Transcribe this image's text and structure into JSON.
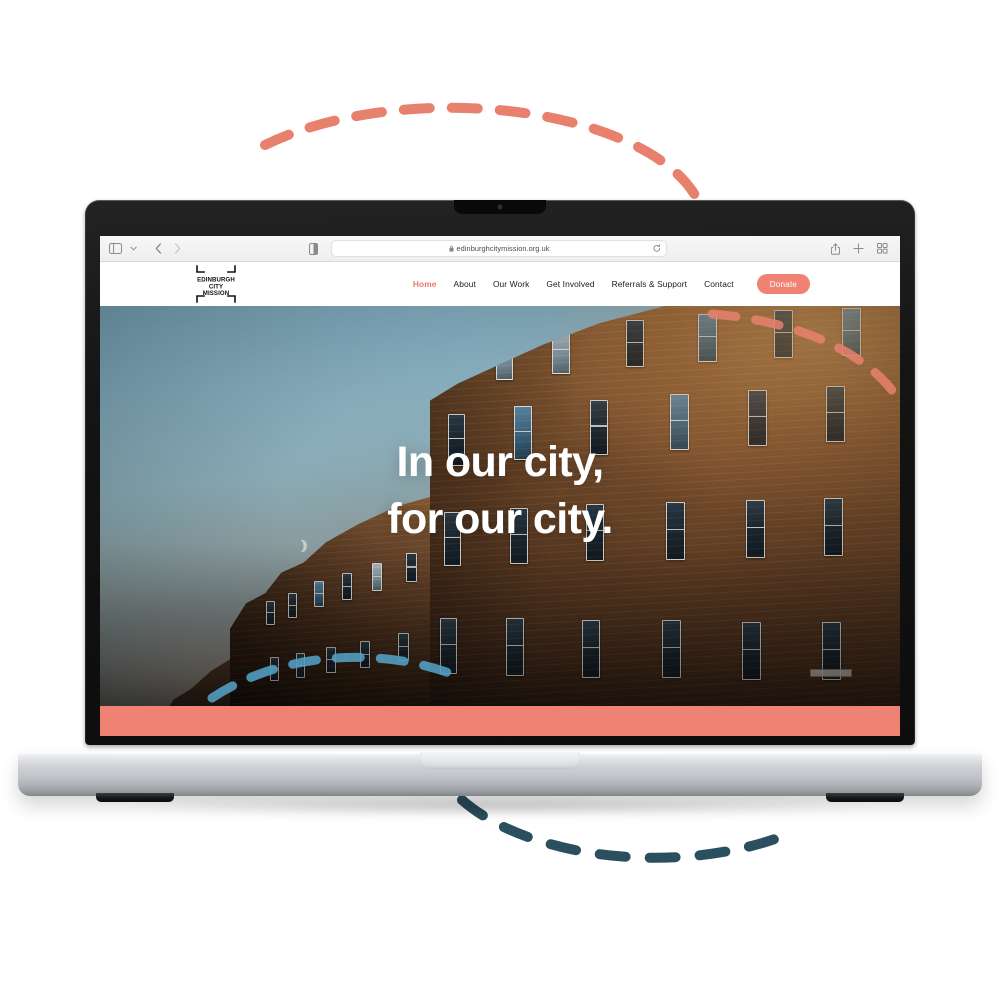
{
  "device": {
    "type": "laptop-mockup",
    "camera_label": "webcam"
  },
  "browser": {
    "app": "safari",
    "url": "edinburghcitymission.org.uk",
    "lock_icon": "lock-icon",
    "reload_icon": "reload-icon",
    "sidebar_icon": "sidebar-toggle-icon",
    "tab_group_chevron": "chevron-down-icon",
    "back_icon": "back-chevron-icon",
    "forward_icon": "forward-chevron-icon",
    "reader_icon": "reader-view-icon",
    "share_icon": "share-icon",
    "new_tab_icon": "plus-icon",
    "tab_overview_icon": "tab-overview-icon"
  },
  "site": {
    "logo": {
      "line1": "EDINBURGH",
      "line2": "CITY",
      "line3": "MISSION",
      "icon": "bracket-frame-logo"
    },
    "nav": [
      {
        "label": "Home",
        "active": true
      },
      {
        "label": "About",
        "active": false
      },
      {
        "label": "Our Work",
        "active": false
      },
      {
        "label": "Get Involved",
        "active": false
      },
      {
        "label": "Referrals & Support",
        "active": false
      },
      {
        "label": "Contact",
        "active": false
      }
    ],
    "donate_label": "Donate",
    "hero": {
      "line1": "In our city,",
      "line2": "for our city.",
      "image_alt": "Edinburgh sandstone tenement street at golden hour with crescent moon"
    }
  },
  "colors": {
    "coral": "#ef8273",
    "coral_accent": "#ec7a68",
    "teal_dark": "#2b4f5e",
    "blue_dash": "#53a0c4",
    "sky": "#84acbd",
    "stone": "#8a5c33",
    "white": "#ffffff",
    "chrome_bg": "#f2f2f2"
  },
  "decor": {
    "top_arc": {
      "name": "coral-dashed-arc-top",
      "color": "#e8806e"
    },
    "bottom_arc": {
      "name": "teal-dashed-arc-bottom",
      "color": "#2b4f5e"
    },
    "hero_blue_arc": {
      "name": "blue-dashed-arc-hero",
      "color": "#53a0c4"
    },
    "hero_coral_arc": {
      "name": "coral-dashed-arc-hero",
      "color": "#e8806e"
    }
  }
}
